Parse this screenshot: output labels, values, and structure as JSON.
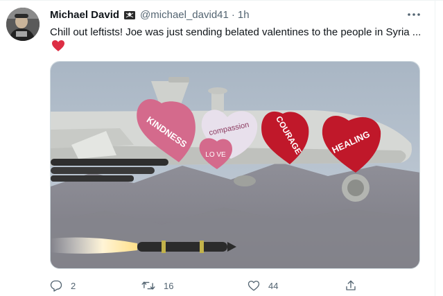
{
  "tweet": {
    "display_name": "Michael David",
    "handle": "@michael_david41",
    "separator": "·",
    "time": "1h",
    "text": "Chill out leftists! Joe was just sending belated valentines to the people in Syria ...",
    "emoji": "red-heart"
  },
  "media": {
    "hearts": [
      {
        "text": "KINDNESS",
        "color": "#d46a8c"
      },
      {
        "text": "compassion",
        "color": "#e8e0ec"
      },
      {
        "text": "LO VE",
        "color": "#d46a8c"
      },
      {
        "text": "COURAGE",
        "color": "#c0182a"
      },
      {
        "text": "HEALING",
        "color": "#c0182a"
      }
    ]
  },
  "actions": {
    "reply_count": "2",
    "retweet_count": "16",
    "like_count": "44"
  },
  "colors": {
    "text_primary": "#0f1419",
    "text_secondary": "#536471",
    "border": "#cfd9de",
    "heart_red": "#e0245e"
  },
  "icons": {
    "more": "more-dots-icon",
    "badge": "pirate-flag-icon",
    "reply": "reply-icon",
    "retweet": "retweet-icon",
    "like": "like-icon",
    "share": "share-icon"
  }
}
